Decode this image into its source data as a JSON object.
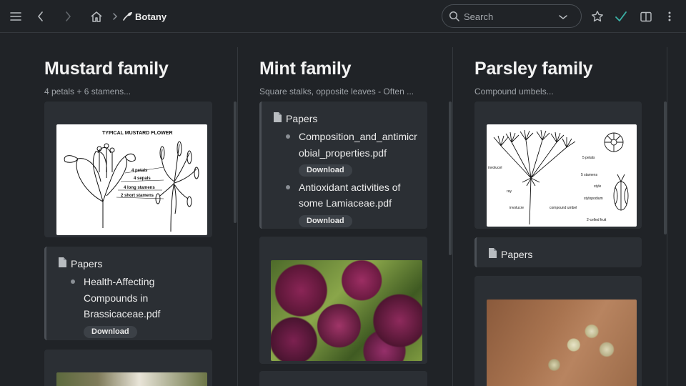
{
  "toolbar": {
    "breadcrumb": "Botany",
    "search_placeholder": "Search",
    "icons": [
      "menu-icon",
      "back-icon",
      "forward-icon",
      "home-icon",
      "leaf-icon",
      "search-icon",
      "chevron-down-icon",
      "star-icon",
      "check-icon",
      "split-view-icon",
      "more-icon"
    ],
    "accent_color": "#3bb3a8"
  },
  "columns": [
    {
      "title": "Mustard family",
      "subtitle": "4 petals + 6 stamens...",
      "image_caption": "TYPICAL MUSTARD FLOWER",
      "image_labels": [
        "4 petals",
        "4 sepals",
        "4 long stamens",
        "2 short stamens"
      ],
      "papers": {
        "heading": "Papers",
        "items": [
          {
            "lines": [
              "Health-Affecting",
              "Compounds in",
              "Brassicaceae.pdf"
            ],
            "button": "Download"
          }
        ]
      }
    },
    {
      "title": "Mint family",
      "subtitle": "Square stalks, opposite leaves - Often ...",
      "papers": {
        "heading": "Papers",
        "items": [
          {
            "lines": [
              "Composition_and_antimicr",
              "obial_properties.pdf"
            ],
            "button": "Download"
          },
          {
            "lines": [
              "Antioxidant activities of",
              "some Lamiaceae.pdf"
            ],
            "button": "Download"
          }
        ]
      }
    },
    {
      "title": "Parsley family",
      "subtitle": "Compound umbels...",
      "image_labels": [
        "involucel",
        "ray",
        "involucre",
        "compound umbel",
        "5 petals",
        "5 stamens",
        "style",
        "stylopodium",
        "2-celled fruit"
      ],
      "papers": {
        "heading": "Papers"
      }
    }
  ]
}
